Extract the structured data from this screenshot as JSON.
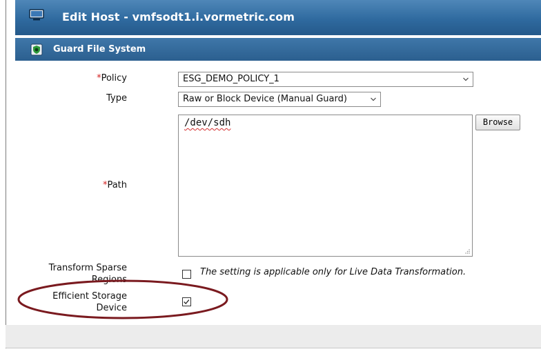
{
  "window": {
    "title": "Edit Host - vmfsodt1.i.vormetric.com"
  },
  "section": {
    "title": "Guard File System"
  },
  "form": {
    "required_marker": "*",
    "policy": {
      "label": "Policy",
      "value": "ESG_DEMO_POLICY_1"
    },
    "type": {
      "label": "Type",
      "value": "Raw or Block Device (Manual Guard)"
    },
    "path": {
      "label": "Path",
      "value": "/dev/sdh",
      "browse_label": "Browse"
    },
    "transform_sparse": {
      "label_line1": "Transform Sparse",
      "label_line2": "Regions",
      "checked": false,
      "hint": "The setting is applicable only for Live Data Transformation."
    },
    "efficient_storage": {
      "label_line1": "Efficient Storage",
      "label_line2": "Device",
      "checked": true
    }
  },
  "colors": {
    "header_blue": "#2f6a9f",
    "required_red": "#d32020",
    "highlight_ellipse": "#7a1a1f"
  },
  "icons": {
    "window": "monitor-icon",
    "section": "shield-icon",
    "dropdown": "chevron-down-icon"
  }
}
